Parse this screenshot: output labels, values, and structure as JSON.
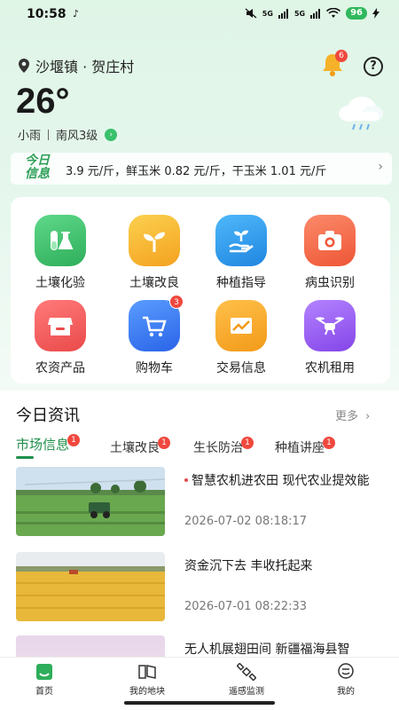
{
  "status_bar": {
    "time": "10:58",
    "battery": "96",
    "net1": "5G",
    "net2": "5G"
  },
  "location": "沙堰镇 · 贺庄村",
  "notification_count": "6",
  "weather": {
    "temperature": "26°",
    "condition": "小雨",
    "wind": "南风3级"
  },
  "today_info": {
    "tag": "今日信息",
    "ticker": "3.9 元/斤，鲜玉米 0.82 元/斤，干玉米 1.01 元/斤"
  },
  "features": [
    {
      "label": "土壤化验",
      "color": "#3bbf6a"
    },
    {
      "label": "土壤改良",
      "color": "#f6b12b"
    },
    {
      "label": "种植指导",
      "color": "#2b9cf0"
    },
    {
      "label": "病虫识别",
      "color": "#f26d4d"
    },
    {
      "label": "农资产品",
      "color": "#f05a5a"
    },
    {
      "label": "购物车",
      "color": "#3a78f2",
      "badge": "3"
    },
    {
      "label": "交易信息",
      "color": "#f5a623"
    },
    {
      "label": "农机租用",
      "color": "#9a5cf0"
    }
  ],
  "news": {
    "title": "今日资讯",
    "more": "更多",
    "tabs": [
      {
        "label": "市场信息",
        "badge": "1"
      },
      {
        "label": "土壤改良",
        "badge": "1"
      },
      {
        "label": "生长防治",
        "badge": "1"
      },
      {
        "label": "种植讲座",
        "badge": "1"
      }
    ],
    "items": [
      {
        "headline": "智慧农机进农田 现代农业提效能",
        "date": "2026-07-02 08:18:17"
      },
      {
        "headline": "资金沉下去 丰收托起来",
        "date": "2026-07-01 08:22:33"
      },
      {
        "headline": "无人机展翅田间 新疆福海县智",
        "date": ""
      }
    ]
  },
  "bottom_nav": [
    {
      "label": "首页"
    },
    {
      "label": "我的地块"
    },
    {
      "label": "遥感监测"
    },
    {
      "label": "我的"
    }
  ],
  "colors": {
    "accent": "#1f8f4a",
    "badge": "#f0483e"
  }
}
